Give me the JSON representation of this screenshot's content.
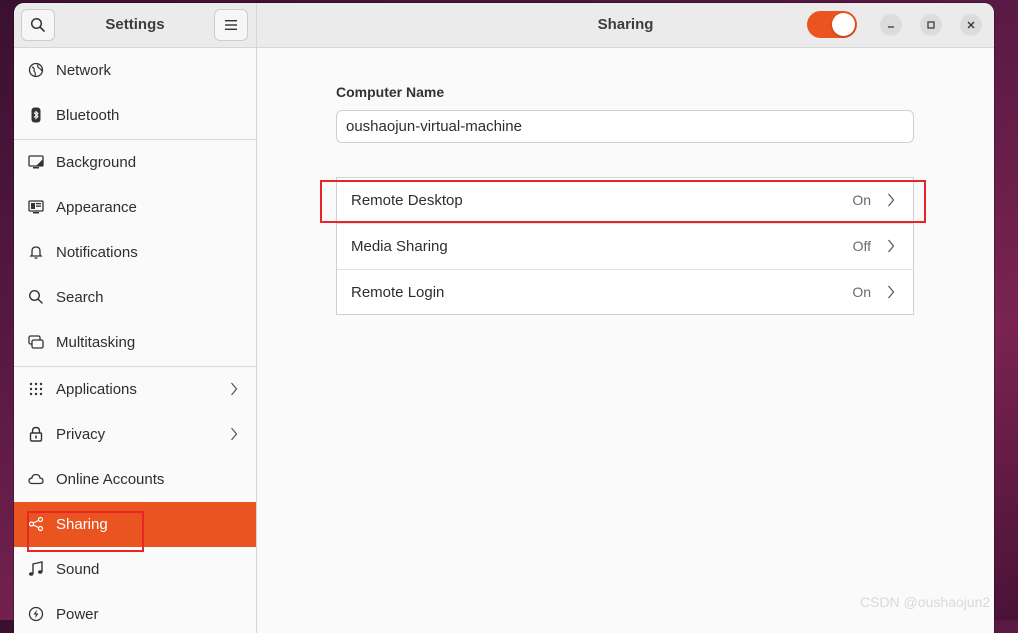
{
  "sidebar": {
    "title": "Settings",
    "items": [
      {
        "label": "Network",
        "icon": "network-icon"
      },
      {
        "label": "Bluetooth",
        "icon": "bluetooth-icon"
      },
      {
        "label": "Background",
        "icon": "background-icon"
      },
      {
        "label": "Appearance",
        "icon": "appearance-icon"
      },
      {
        "label": "Notifications",
        "icon": "bell-icon"
      },
      {
        "label": "Search",
        "icon": "search-icon"
      },
      {
        "label": "Multitasking",
        "icon": "multitasking-icon"
      },
      {
        "label": "Applications",
        "icon": "apps-grid-icon"
      },
      {
        "label": "Privacy",
        "icon": "lock-icon"
      },
      {
        "label": "Online Accounts",
        "icon": "cloud-icon"
      },
      {
        "label": "Sharing",
        "icon": "share-icon",
        "active": true
      },
      {
        "label": "Sound",
        "icon": "music-note-icon"
      },
      {
        "label": "Power",
        "icon": "power-icon"
      }
    ]
  },
  "header": {
    "title": "Sharing",
    "sharing_toggle_on": true
  },
  "main": {
    "computer_name_label": "Computer Name",
    "computer_name_value": "oushaojun-virtual-machine",
    "rows": [
      {
        "label": "Remote Desktop",
        "status": "On"
      },
      {
        "label": "Media Sharing",
        "status": "Off"
      },
      {
        "label": "Remote Login",
        "status": "On"
      }
    ]
  },
  "watermark": "CSDN @oushaojun2",
  "colors": {
    "accent": "#e95420",
    "annotation": "#e8262a"
  }
}
